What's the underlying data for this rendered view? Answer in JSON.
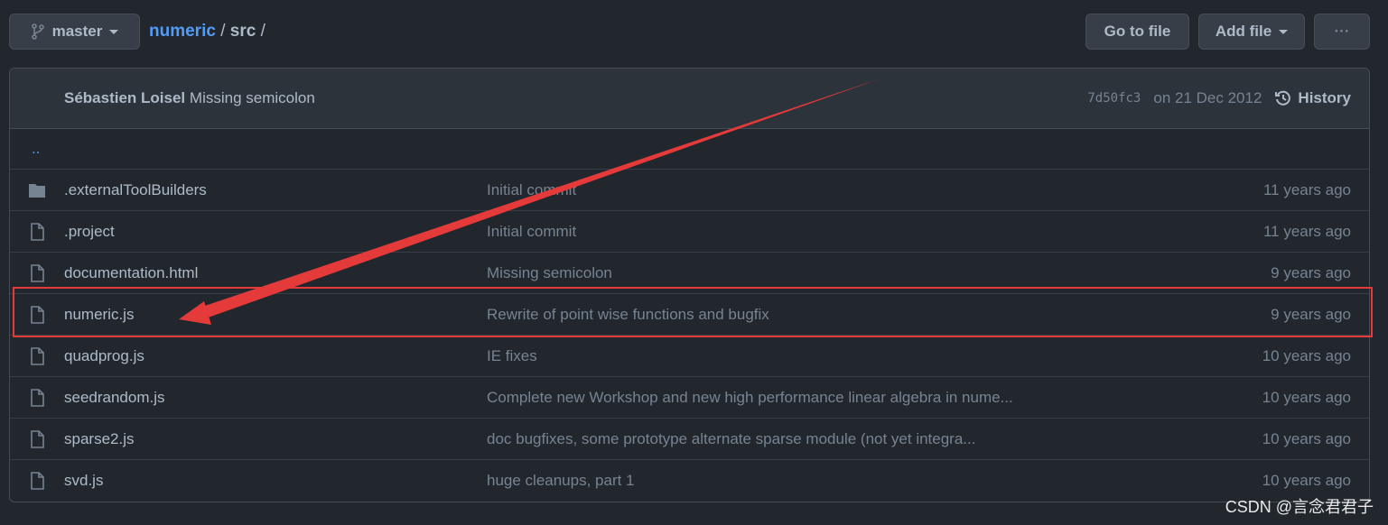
{
  "toolbar": {
    "branch": "master",
    "go_to_file": "Go to file",
    "add_file": "Add file",
    "more": "···"
  },
  "breadcrumb": {
    "repo": "numeric",
    "sep1": "/",
    "dir": "src",
    "sep2": "/"
  },
  "commit": {
    "author": "Sébastien Loisel",
    "message": "Missing semicolon",
    "sha": "7d50fc3",
    "date": "on 21 Dec 2012",
    "history": "History"
  },
  "parent": "..",
  "files": [
    {
      "type": "folder",
      "name": ".externalToolBuilders",
      "message": "Initial commit",
      "age": "11 years ago"
    },
    {
      "type": "file",
      "name": ".project",
      "message": "Initial commit",
      "age": "11 years ago"
    },
    {
      "type": "file",
      "name": "documentation.html",
      "message": "Missing semicolon",
      "age": "9 years ago"
    },
    {
      "type": "file",
      "name": "numeric.js",
      "message": "Rewrite of point wise functions and bugfix",
      "age": "9 years ago"
    },
    {
      "type": "file",
      "name": "quadprog.js",
      "message": "IE fixes",
      "age": "10 years ago"
    },
    {
      "type": "file",
      "name": "seedrandom.js",
      "message": "Complete new Workshop and new high performance linear algebra in nume...",
      "age": "10 years ago"
    },
    {
      "type": "file",
      "name": "sparse2.js",
      "message": "doc bugfixes, some prototype alternate sparse module (not yet integra...",
      "age": "10 years ago"
    },
    {
      "type": "file",
      "name": "svd.js",
      "message": "huge cleanups, part 1",
      "age": "10 years ago"
    }
  ],
  "annotation": {
    "color": "#e53a3a",
    "highlighted": "numeric.js"
  },
  "watermark": "CSDN @言念君君子"
}
